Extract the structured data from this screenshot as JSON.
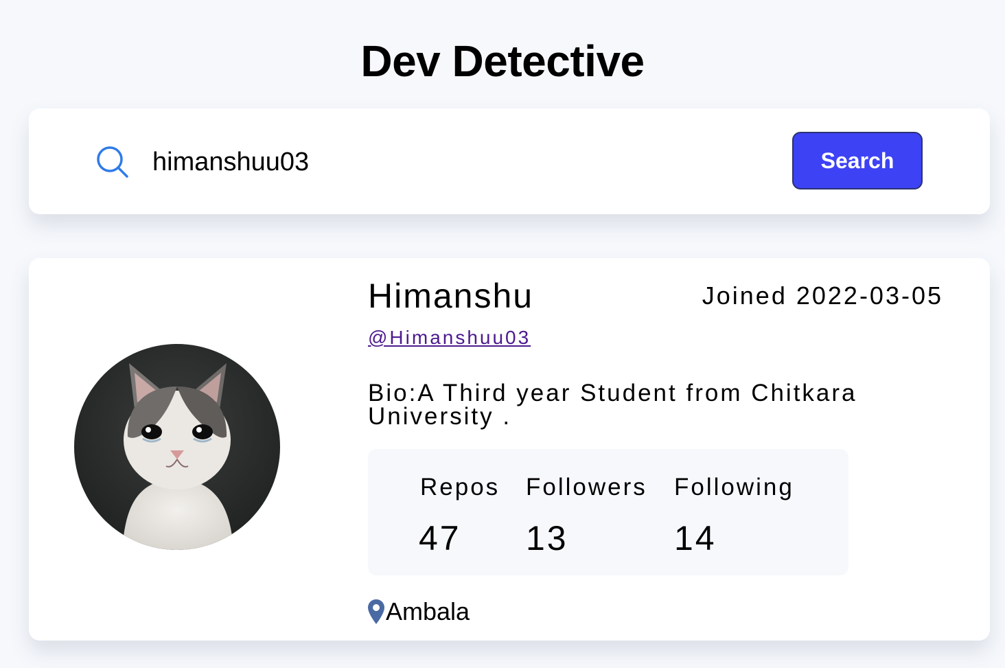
{
  "app": {
    "title": "Dev Detective"
  },
  "search": {
    "icon": "search-icon",
    "value": "himanshuu03",
    "button_label": "Search",
    "accent_color": "#3d42f5"
  },
  "profile": {
    "name": "Himanshu",
    "joined": "Joined 2022-03-05",
    "username": "@Himanshuu03",
    "bio": "Bio:A Third year Student from Chitkara University .",
    "stats": [
      {
        "label": "Repos",
        "value": "47"
      },
      {
        "label": "Followers",
        "value": "13"
      },
      {
        "label": "Following",
        "value": "14"
      }
    ],
    "location": "Ambala",
    "location_icon": "map-pin-icon",
    "avatar": "avatar"
  }
}
